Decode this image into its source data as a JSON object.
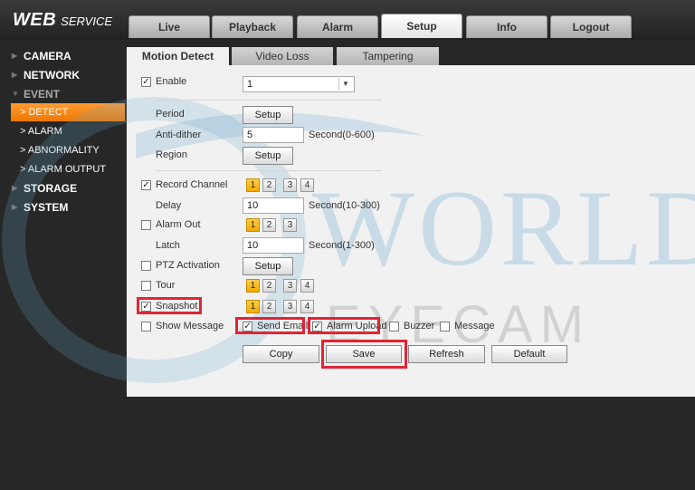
{
  "logo": {
    "primary": "WEB",
    "secondary": "SERVICE"
  },
  "main_tabs": [
    "Live",
    "Playback",
    "Alarm",
    "Setup",
    "Info",
    "Logout"
  ],
  "sidebar": {
    "camera": "CAMERA",
    "network": "NETWORK",
    "event": "EVENT",
    "detect": "> DETECT",
    "alarm": "> ALARM",
    "abnormality": "> ABNORMALITY",
    "alarm_output": "> ALARM OUTPUT",
    "storage": "STORAGE",
    "system": "SYSTEM"
  },
  "sub_tabs": [
    "Motion Detect",
    "Video Loss",
    "Tampering"
  ],
  "form": {
    "enable_label": "Enable",
    "enable_value": "1",
    "period_label": "Period",
    "setup_label": "Setup",
    "anti_dither_label": "Anti-dither",
    "anti_dither_value": "5",
    "anti_dither_unit": "Second(0-600)",
    "region_label": "Region",
    "record_channel_label": "Record Channel",
    "delay_label": "Delay",
    "delay_value": "10",
    "delay_unit": "Second(10-300)",
    "alarm_out_label": "Alarm Out",
    "latch_label": "Latch",
    "latch_value": "10",
    "latch_unit": "Second(1-300)",
    "ptz_label": "PTZ Activation",
    "tour_label": "Tour",
    "snapshot_label": "Snapshot",
    "show_message_label": "Show Message",
    "send_email_label": "Send Email",
    "alarm_upload_label": "Alarm Upload",
    "buzzer_label": "Buzzer",
    "message_label": "Message",
    "ch1": "1",
    "ch2": "2",
    "ch3": "3",
    "ch4": "4"
  },
  "buttons": {
    "copy": "Copy",
    "save": "Save",
    "refresh": "Refresh",
    "default": "Default"
  },
  "watermark": {
    "line1": "WORLD",
    "line2": "EYECAM"
  },
  "colors": {
    "accent": "#f5a800",
    "highlight": "#e22434",
    "active_nav": "#f07800"
  }
}
